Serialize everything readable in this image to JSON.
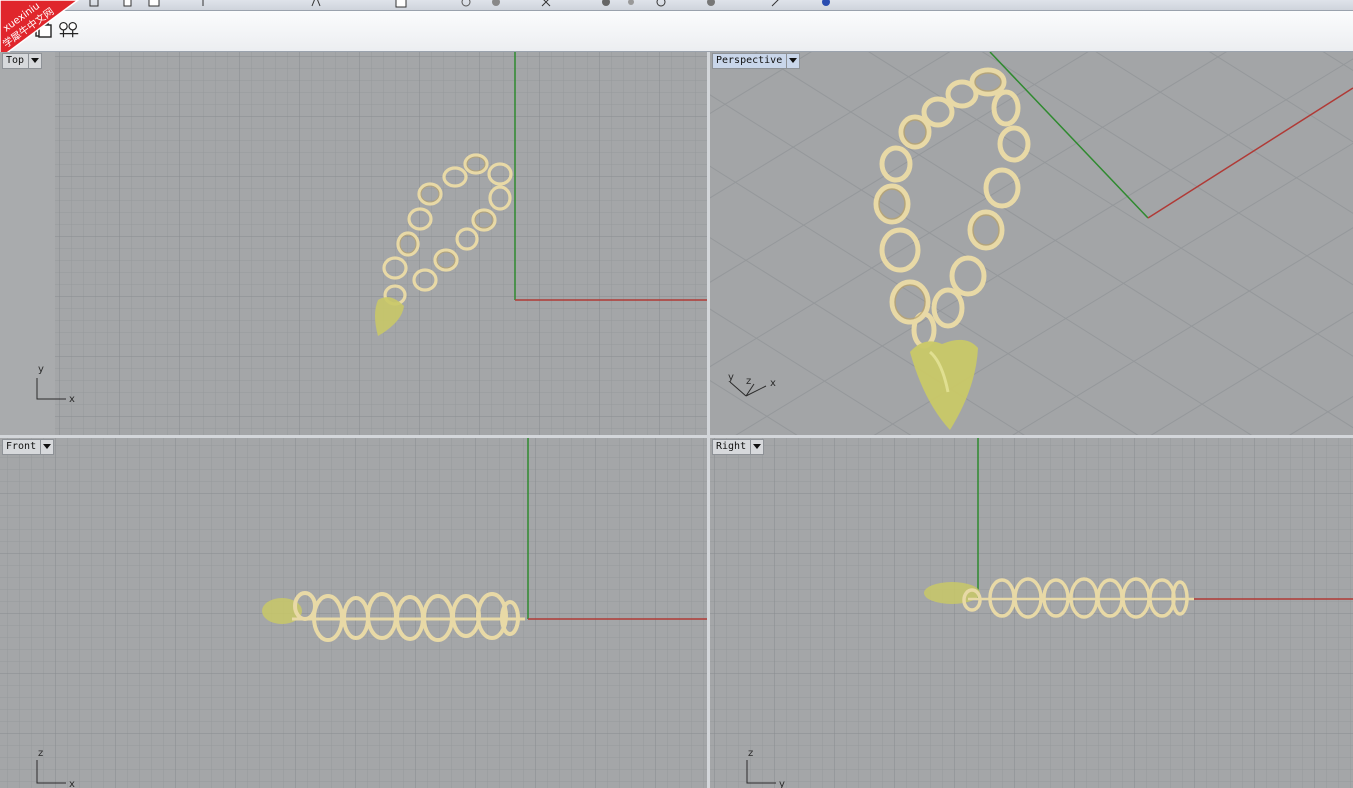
{
  "toolbar": {
    "icons": [
      "toolbar-icon",
      "toolbar-icon",
      "toolbar-icon",
      "toolbar-icon",
      "toolbar-icon",
      "toolbar-icon",
      "toolbar-icon",
      "toolbar-icon",
      "toolbar-icon",
      "toolbar-icon",
      "toolbar-icon",
      "toolbar-icon",
      "toolbar-icon",
      "toolbar-icon",
      "toolbar-icon"
    ],
    "secondary": [
      "layer-icon",
      "group-icon"
    ]
  },
  "watermark": {
    "text": "xuexiniu 学犀牛中文网",
    "color": "#e0262c"
  },
  "viewports": {
    "top": {
      "label": "Top",
      "axis_a": "y",
      "axis_b": "x"
    },
    "perspective": {
      "label": "Perspective",
      "axis_a": "y",
      "axis_b": "z",
      "axis_c": "x"
    },
    "front": {
      "label": "Front",
      "axis_a": "z",
      "axis_b": "x"
    },
    "right": {
      "label": "Right",
      "axis_a": "z",
      "axis_b": "y"
    }
  },
  "colors": {
    "viewport_bg": "#a3a5a7",
    "grid_minor": "#979a9d",
    "grid_major": "#8a8d90",
    "x_axis": "#b03a36",
    "y_axis": "#2f8a2f",
    "z_axis": "#2f8a2f",
    "chain_gold": "#e8d9a6",
    "chain_shadow": "#b9a36a",
    "pendant": "#c9c867"
  }
}
